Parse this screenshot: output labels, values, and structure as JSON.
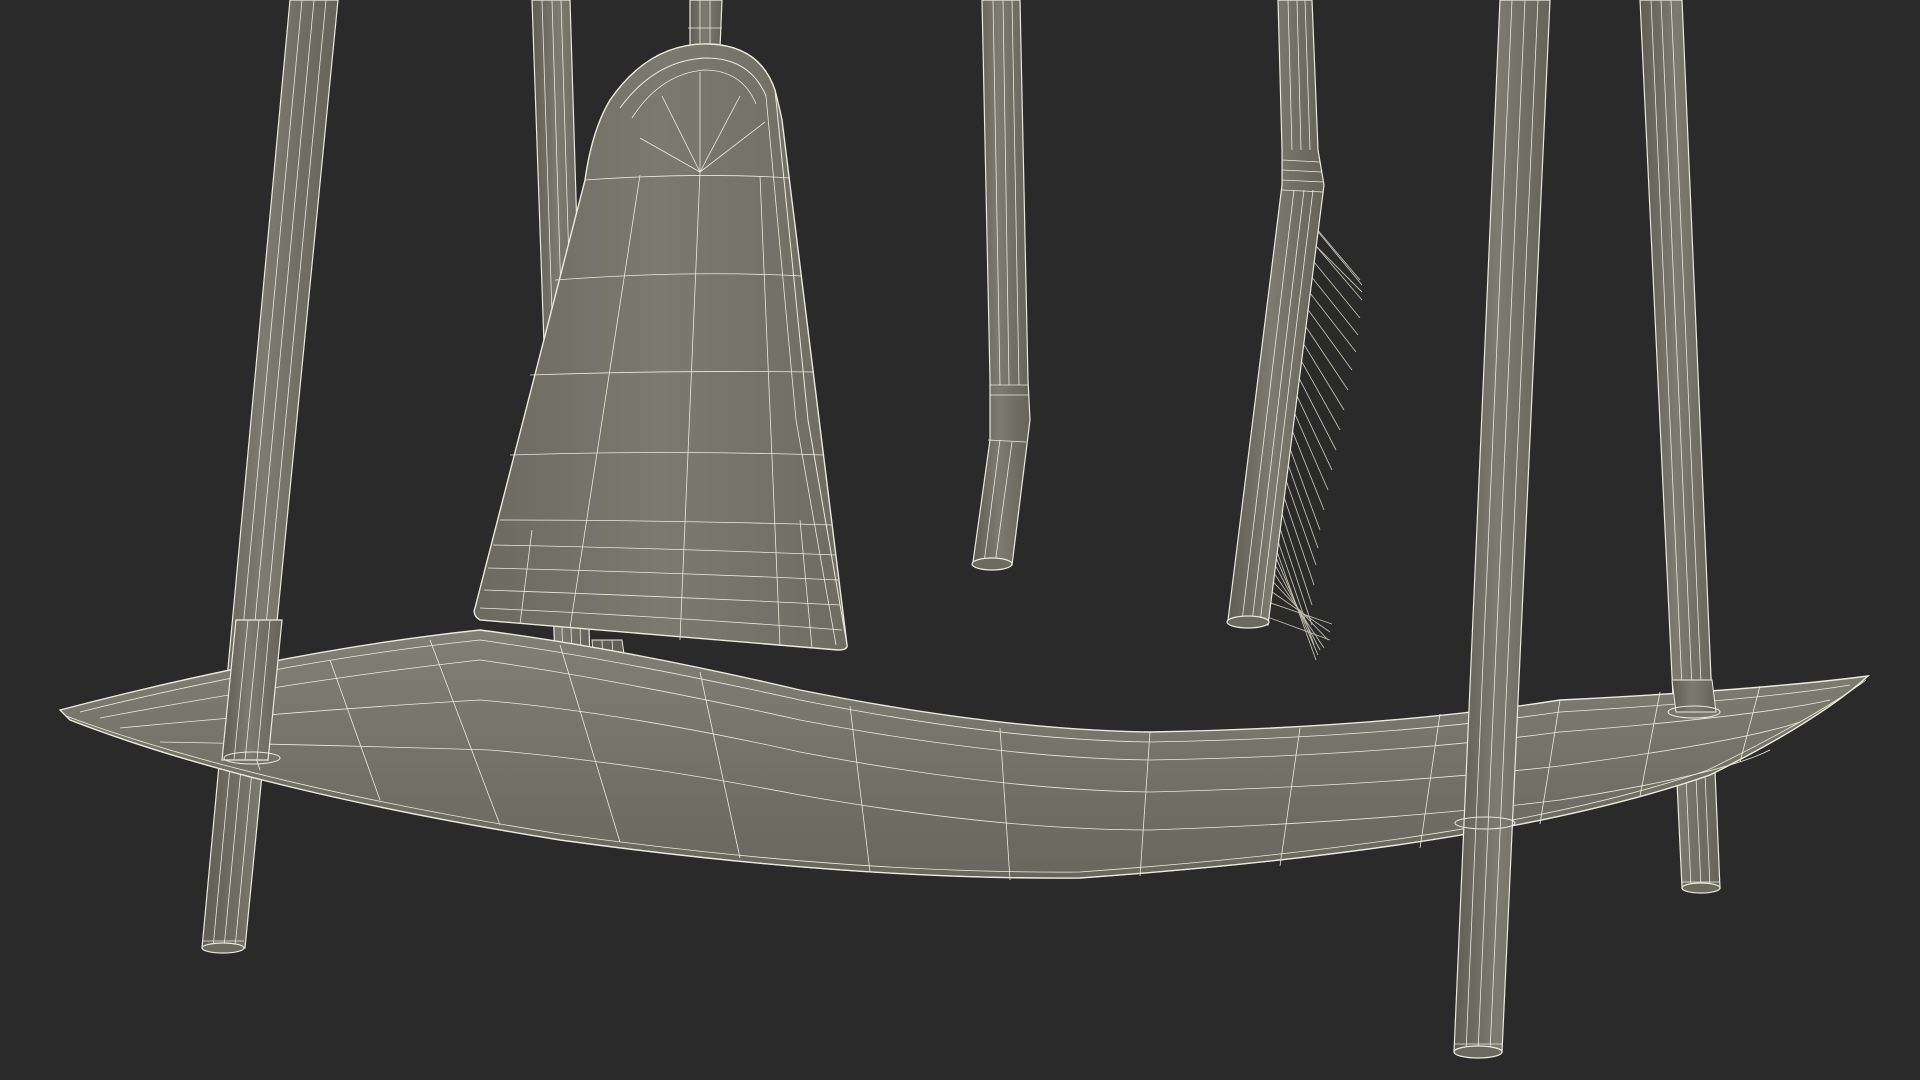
{
  "colors": {
    "background": "#2a2a2a",
    "surface": "#74746a",
    "surface_dark": "#5f5f56",
    "surface_light": "#8a8a7e",
    "wire": "#e9e9dc",
    "bristle": "#bdbcae"
  },
  "scene": {
    "subject": "fireplace-tool-set-wireframe",
    "parts": [
      "stand-leg",
      "stand-leg",
      "stand-leg",
      "stand-leg",
      "shovel-handle",
      "dustpan",
      "poker",
      "brush",
      "base-tray"
    ]
  }
}
